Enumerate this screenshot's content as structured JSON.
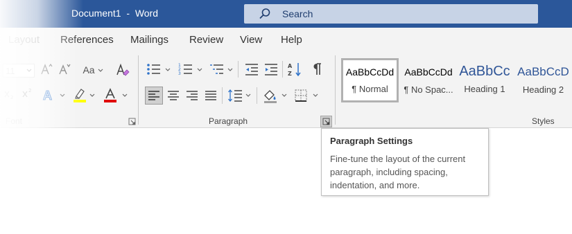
{
  "titlebar": {
    "document_title": "Document1  -  Word",
    "search_label": "Search"
  },
  "tabs": [
    {
      "label": "Layout"
    },
    {
      "label": "References"
    },
    {
      "label": "Mailings"
    },
    {
      "label": "Review"
    },
    {
      "label": "View"
    },
    {
      "label": "Help"
    }
  ],
  "ribbon": {
    "font_group": {
      "label": "Font",
      "font_size": "11",
      "change_case_label": "Aa"
    },
    "paragraph_group": {
      "label": "Paragraph"
    },
    "styles_group": {
      "label": "Styles",
      "styles": [
        {
          "sample": "AaBbCcDd",
          "name": "¶ Normal",
          "selected": true
        },
        {
          "sample": "AaBbCcDd",
          "name": "¶ No Spac..."
        },
        {
          "sample": "AaBbCc",
          "name": "Heading 1"
        },
        {
          "sample": "AaBbCcD",
          "name": "Heading 2"
        }
      ]
    }
  },
  "tooltip": {
    "title": "Paragraph Settings",
    "body": "Fine-tune the layout of the current paragraph, including spacing, indentation, and more."
  },
  "colors": {
    "titlebar": "#2b579a",
    "ribbon_bg": "#f3f3f3",
    "highlight": "#ffff00",
    "font_color": "#e00000",
    "heading_blue": "#2f5597"
  }
}
